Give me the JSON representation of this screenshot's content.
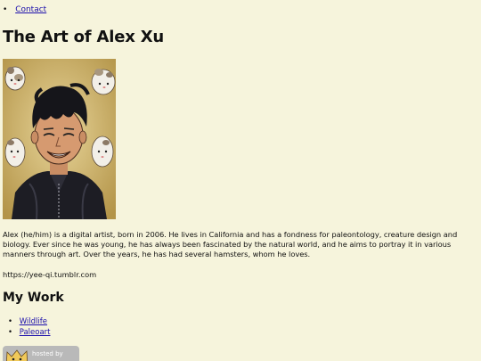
{
  "nav": {
    "items": [
      {
        "label": "Contact"
      }
    ]
  },
  "header": {
    "title": "The Art of Alex Xu"
  },
  "portrait": {
    "alt": "Portrait of Alex Xu"
  },
  "bio": {
    "text": "Alex (he/him) is a digital artist, born in 2006. He lives in California and has a fondness for paleontology, creature design and biology. Ever since he was young, he has always been fascinated by the natural world, and he aims to portray it in various manners through art. Over the years, he has had several hamsters, whom he loves.",
    "url": "https://yee-qi.tumblr.com"
  },
  "work": {
    "heading": "My Work",
    "items": [
      {
        "label": "Wildlife"
      },
      {
        "label": "Paleoart"
      }
    ]
  },
  "badge": {
    "text": "hosted by"
  },
  "colors": {
    "background": "#f6f4dc",
    "link": "#1a0dab",
    "badge": "#b9b9b9"
  }
}
